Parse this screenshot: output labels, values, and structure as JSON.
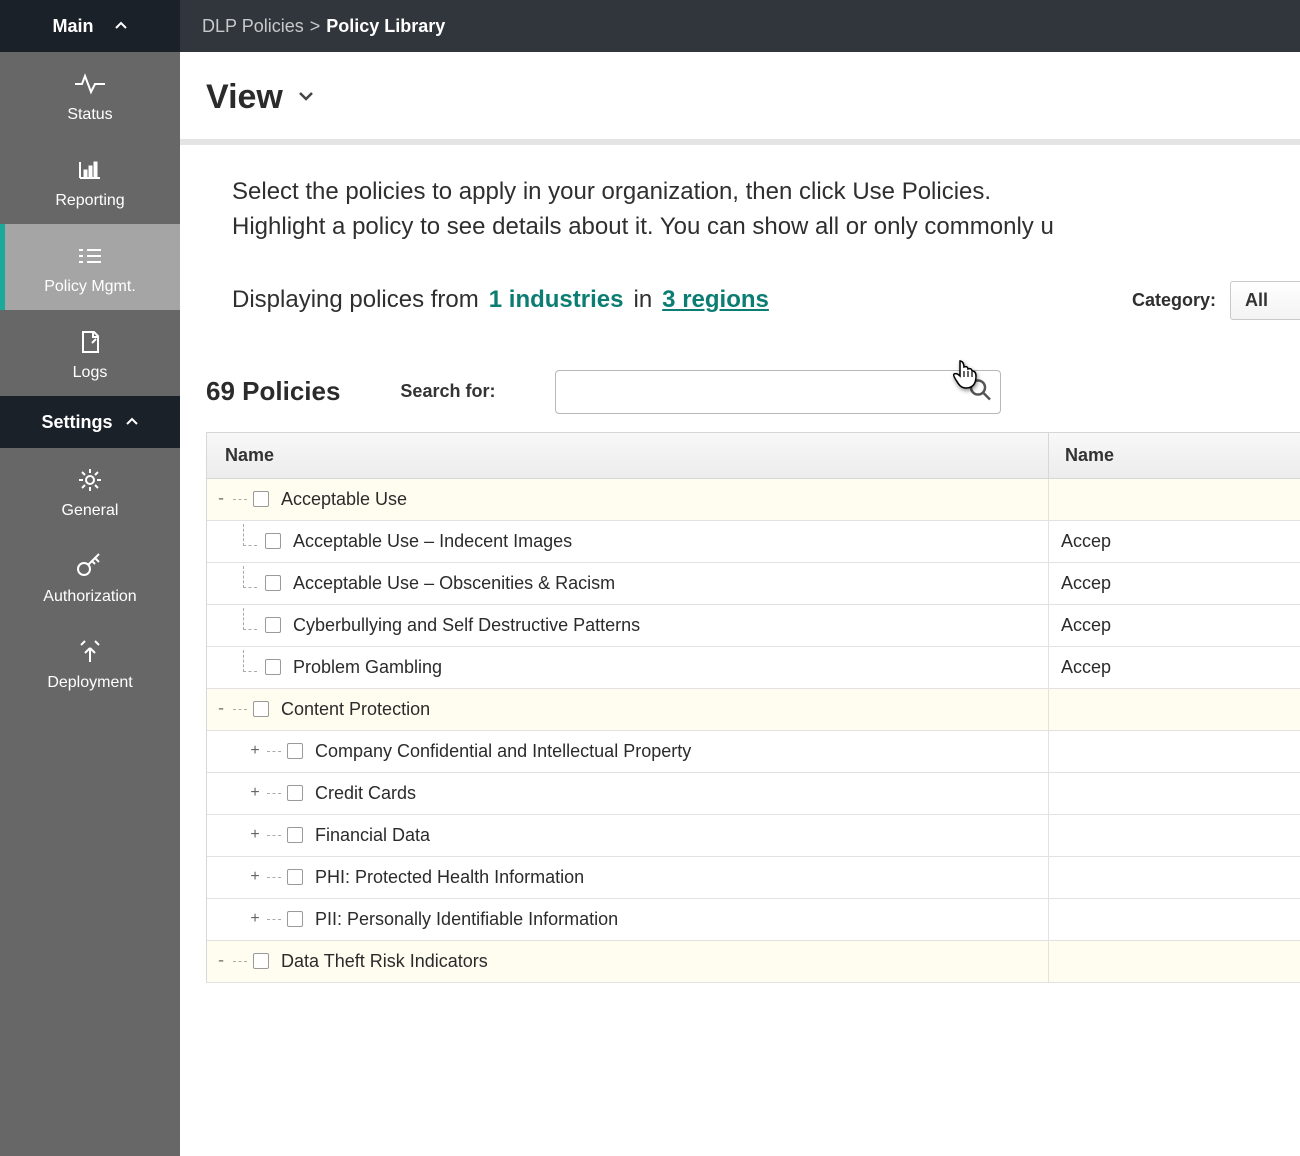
{
  "sidebar": {
    "main_header": "Main",
    "settings_header": "Settings",
    "items_main": [
      {
        "key": "status",
        "label": "Status"
      },
      {
        "key": "reporting",
        "label": "Reporting"
      },
      {
        "key": "policy",
        "label": "Policy Mgmt."
      },
      {
        "key": "logs",
        "label": "Logs"
      }
    ],
    "items_settings": [
      {
        "key": "general",
        "label": "General"
      },
      {
        "key": "authorization",
        "label": "Authorization"
      },
      {
        "key": "deployment",
        "label": "Deployment"
      }
    ]
  },
  "breadcrumb": {
    "parent": "DLP Policies",
    "sep": ">",
    "current": "Policy Library"
  },
  "view_label": "View",
  "intro_line1": "Select the policies to apply in your organization, then click Use Policies.",
  "intro_line2": "Highlight a policy to see details about it. You can show all or only commonly u",
  "filter": {
    "prefix": "Displaying polices from",
    "industries": "1 industries",
    "in": "in",
    "regions": "3 regions"
  },
  "category": {
    "label": "Category:",
    "value": "All"
  },
  "count": {
    "text": "69 Policies",
    "search_label": "Search for:"
  },
  "columns": {
    "col1": "Name",
    "col2": "Name"
  },
  "rows": [
    {
      "type": "group",
      "toggle": "-",
      "label": "Acceptable Use",
      "right": ""
    },
    {
      "type": "child",
      "label": "Acceptable Use – Indecent Images",
      "right": "Accep"
    },
    {
      "type": "child",
      "label": "Acceptable Use – Obscenities & Racism",
      "right": "Accep"
    },
    {
      "type": "child",
      "label": "Cyberbullying and Self Destructive Patterns",
      "right": "Accep"
    },
    {
      "type": "child",
      "label": "Problem Gambling",
      "right": "Accep"
    },
    {
      "type": "group",
      "toggle": "-",
      "label": "Content Protection",
      "right": ""
    },
    {
      "type": "childexp",
      "toggle": "+",
      "label": "Company Confidential and Intellectual Property",
      "right": ""
    },
    {
      "type": "childexp",
      "toggle": "+",
      "label": "Credit Cards",
      "right": ""
    },
    {
      "type": "childexp",
      "toggle": "+",
      "label": "Financial Data",
      "right": ""
    },
    {
      "type": "childexp",
      "toggle": "+",
      "label": "PHI: Protected Health Information",
      "right": ""
    },
    {
      "type": "childexp",
      "toggle": "+",
      "label": "PII: Personally Identifiable Information",
      "right": ""
    },
    {
      "type": "group",
      "toggle": "-",
      "label": "Data Theft Risk Indicators",
      "right": ""
    }
  ]
}
